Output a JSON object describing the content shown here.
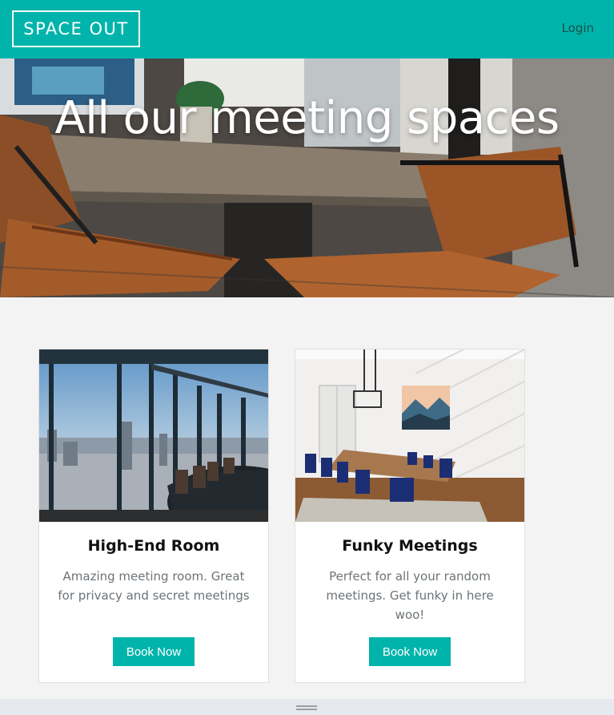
{
  "navbar": {
    "logo": "SPACE OUT",
    "login": "Login"
  },
  "hero": {
    "title": "All our meeting spaces"
  },
  "cards": [
    {
      "title": "High-End Room",
      "description": "Amazing meeting room. Great for privacy and secret meetings",
      "button": "Book Now"
    },
    {
      "title": "Funky Meetings",
      "description": "Perfect for all your random meetings. Get funky in here woo!",
      "button": "Book Now"
    }
  ],
  "colors": {
    "accent": "#00b4ab",
    "background": "#f3f3f3",
    "text_muted": "#6c7378"
  }
}
